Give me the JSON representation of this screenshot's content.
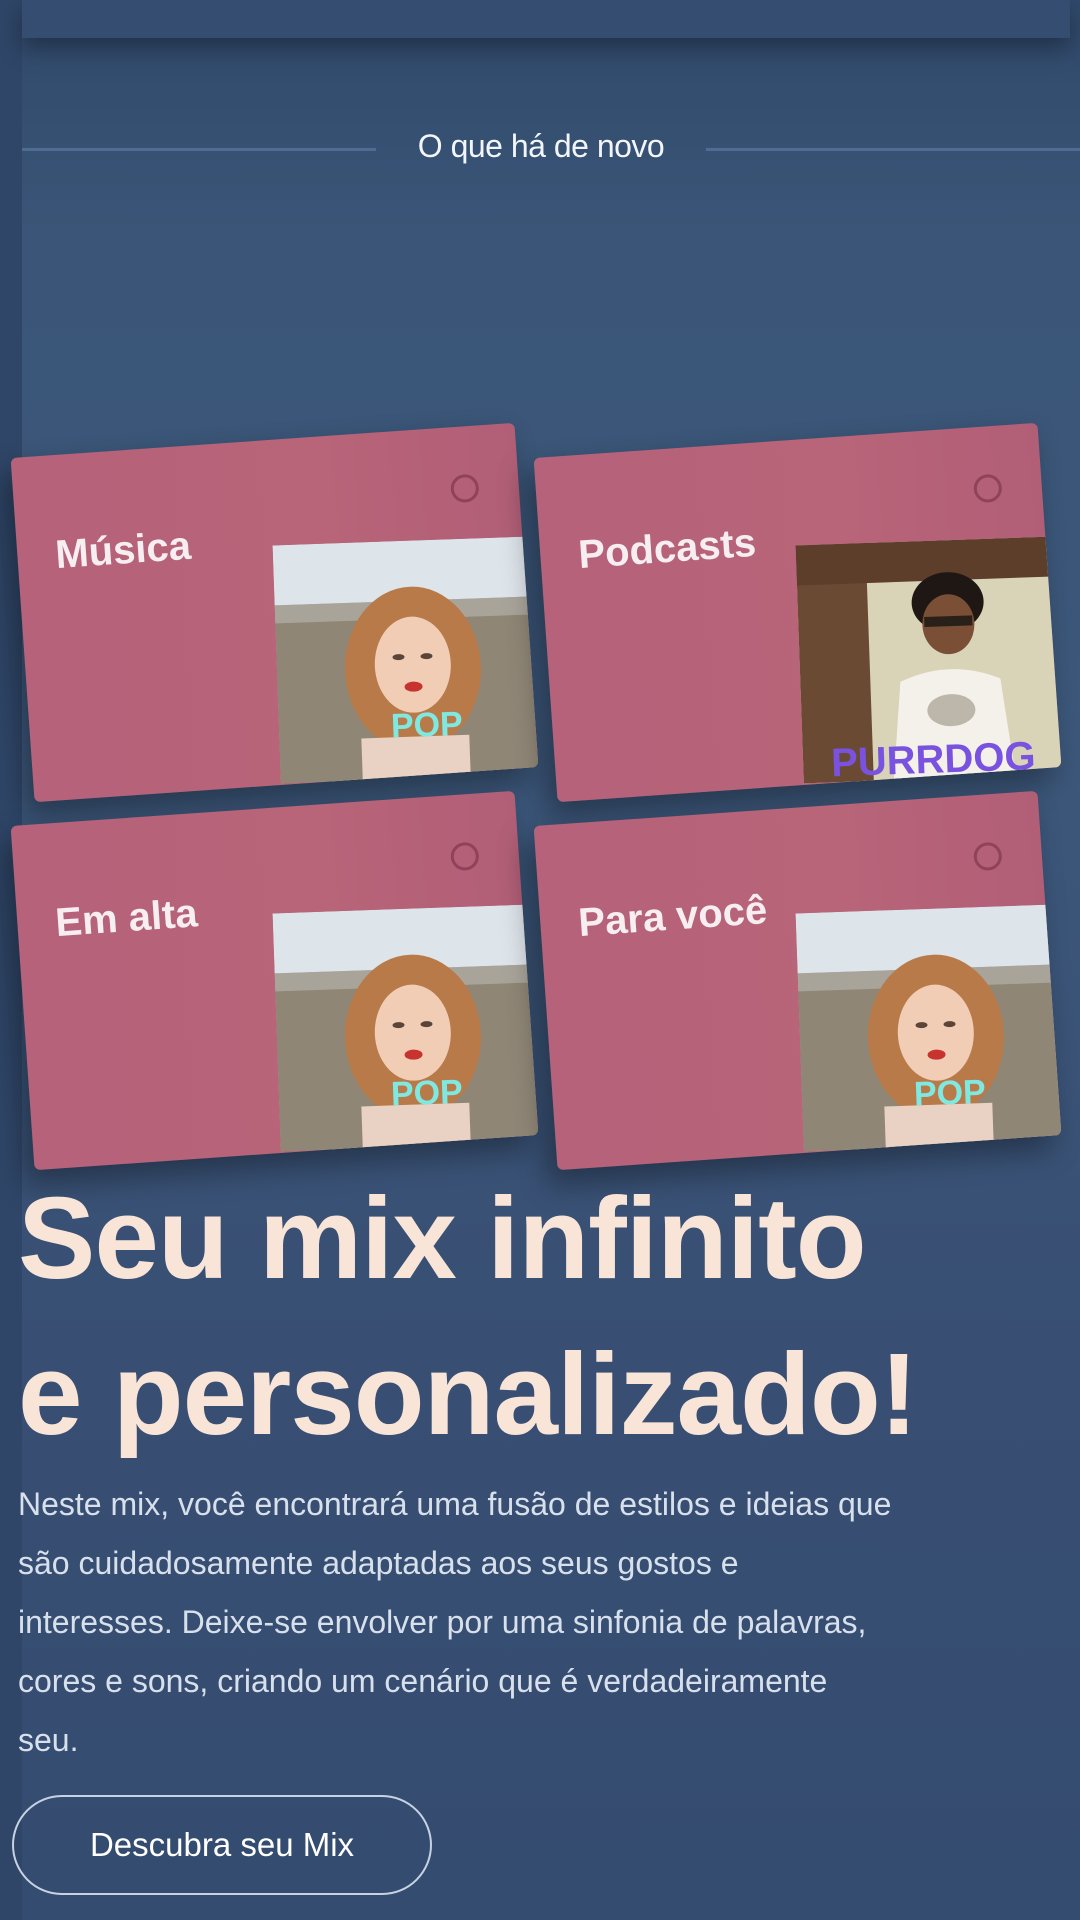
{
  "section": {
    "title": "O que há de novo"
  },
  "cards": [
    {
      "label": "Música",
      "cover_text": "POP",
      "cover_type": "portrait-woman"
    },
    {
      "label": "Podcasts",
      "cover_text": "PURRDOG",
      "cover_type": "portrait-man"
    },
    {
      "label": "Em alta",
      "cover_text": "POP",
      "cover_type": "portrait-woman"
    },
    {
      "label": "Para você",
      "cover_text": "POP",
      "cover_type": "portrait-woman"
    }
  ],
  "hero": {
    "headline_line1": "Seu mix infinito",
    "headline_line2": "e personalizado!",
    "paragraph_lines": [
      "Neste mix, você encontrará uma fusão de estilos e ideias que",
      "são cuidadosamente adaptadas aos seus gostos e",
      "interesses. Deixe-se envolver por uma sinfonia de palavras,",
      "cores e sons, criando um cenário que é verdadeiramente",
      "seu."
    ],
    "cta_label": "Descubra seu Mix"
  },
  "colors": {
    "background": "#3a5578",
    "card": "#b5627a",
    "headline": "#f9e4d8",
    "accent_teal": "#7fe8e0",
    "accent_purple": "#7a52e0"
  }
}
